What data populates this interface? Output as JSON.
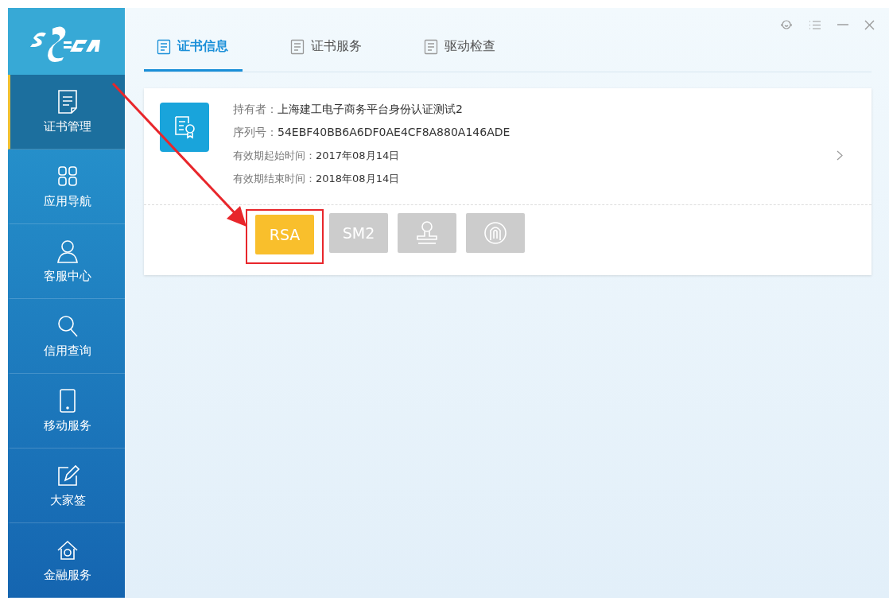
{
  "sidebar": {
    "items": [
      {
        "label": "证书管理",
        "selected": true
      },
      {
        "label": "应用导航",
        "selected": false
      },
      {
        "label": "客服中心",
        "selected": false
      },
      {
        "label": "信用查询",
        "selected": false
      },
      {
        "label": "移动服务",
        "selected": false
      },
      {
        "label": "大家签",
        "selected": false
      },
      {
        "label": "金融服务",
        "selected": false
      }
    ]
  },
  "tabs": [
    {
      "label": "证书信息",
      "selected": true
    },
    {
      "label": "证书服务",
      "selected": false
    },
    {
      "label": "驱动检查",
      "selected": false
    }
  ],
  "certificate": {
    "fields": [
      {
        "label": "持有者：",
        "value": "上海建工电子商务平台身份认证测试2",
        "kind": "large"
      },
      {
        "label": "序列号：",
        "value": "54EBF40BB6A6DF0AE4CF8A880A146ADE",
        "kind": "large"
      },
      {
        "label": "有效期起始时间：",
        "value": "2017年08月14日",
        "kind": "small"
      },
      {
        "label": "有效期结束时间：",
        "value": "2018年08月14日",
        "kind": "small"
      }
    ],
    "algorithms": [
      {
        "kind": "text",
        "label": "RSA",
        "selected": true,
        "highlighted": true
      },
      {
        "kind": "text",
        "label": "SM2",
        "selected": false,
        "highlighted": false
      },
      {
        "kind": "stamp",
        "selected": false,
        "highlighted": false
      },
      {
        "kind": "fingerprint",
        "selected": false,
        "highlighted": false
      }
    ]
  }
}
